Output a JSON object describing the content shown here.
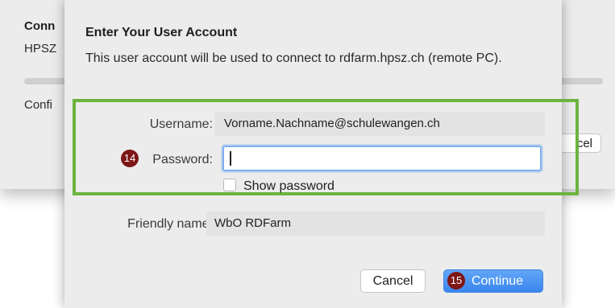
{
  "background_window": {
    "title": "Conn",
    "subtitle": "HPSZ",
    "config_label": "Confi",
    "cancel_label": "cel"
  },
  "dialog": {
    "title": "Enter Your User Account",
    "description": "This user account will be used to connect to rdfarm.hpsz.ch (remote PC).",
    "username_label": "Username:",
    "username_value": "Vorname.Nachname@schulewangen.ch",
    "password_label": "Password:",
    "password_value": "",
    "show_password_label": "Show password",
    "show_password_checked": false,
    "friendly_name_label": "Friendly name:",
    "friendly_name_value": "WbO RDFarm",
    "cancel_label": "Cancel",
    "continue_label": "Continue"
  },
  "annotations": {
    "badge_password": "14",
    "badge_continue": "15",
    "highlight_color": "#6cb33f",
    "badge_color": "#7d1616",
    "accent_color": "#3a86ee"
  }
}
